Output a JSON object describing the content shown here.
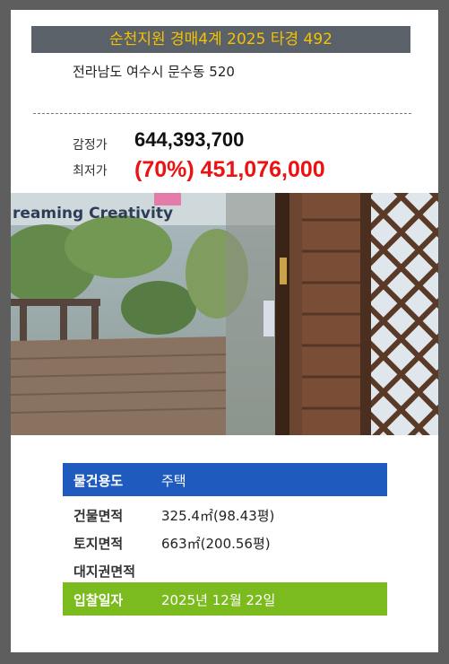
{
  "listing": {
    "banner_title": "순천지원 경매4계 2025 타경 492",
    "address": "전라남도 여수시 문수동 520"
  },
  "prices": {
    "appraised_label": "감정가",
    "appraised_value": "644,393,700",
    "minimum_label": "최저가",
    "minimum_value": "(70%) 451,076,000"
  },
  "photo": {
    "sign_text": "reaming Creativity"
  },
  "details": {
    "usage_label": "물건용도",
    "usage_value": "주택",
    "building_area_label": "건물면적",
    "building_area_value": "325.4㎡(98.43평)",
    "land_area_label": "토지면적",
    "land_area_value": "663㎡(200.56평)",
    "land_right_label": "대지권면적",
    "land_right_value": "",
    "bid_date_label": "입찰일자",
    "bid_date_value": "2025년 12월 22일"
  },
  "colors": {
    "banner_bg": "#5a6168",
    "banner_text": "#f5c200",
    "minimum_price": "#ee1111",
    "usage_row": "#1f5bbf",
    "bid_date_row": "#7cbb1d"
  }
}
